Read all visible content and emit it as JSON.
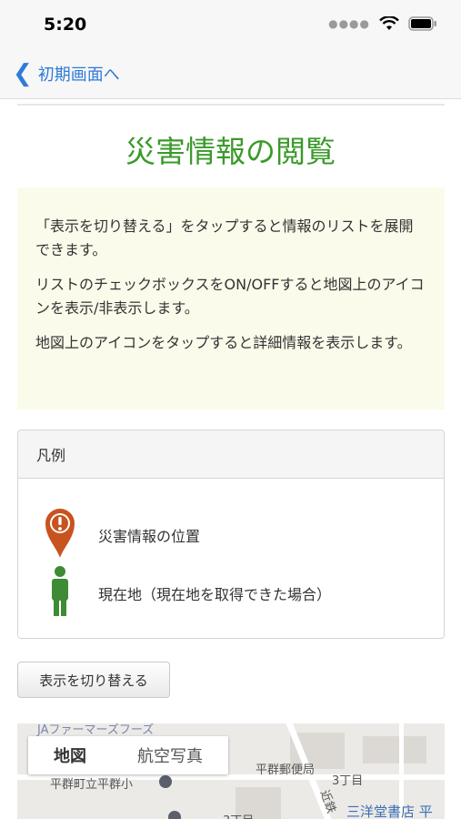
{
  "status_bar": {
    "time": "5:20"
  },
  "nav": {
    "back_label": "初期画面へ"
  },
  "page": {
    "title": "災害情報の閲覧"
  },
  "info": {
    "paragraphs": [
      "「表示を切り替える」をタップすると情報のリストを展開できます。",
      "リストのチェックボックスをON/OFFすると地図上のアイコンを表示/非表示します。",
      "地図上のアイコンをタップすると詳細情報を表示します。"
    ]
  },
  "legend": {
    "title": "凡例",
    "items": [
      {
        "icon": "disaster-pin-icon",
        "color": "#c8531f",
        "label": "災害情報の位置"
      },
      {
        "icon": "person-icon",
        "color": "#3f8a35",
        "label": "現在地（現在地を取得できた場合）"
      }
    ]
  },
  "toggle_button_label": "表示を切り替える",
  "map": {
    "tabs": [
      "地図",
      "航空写真"
    ],
    "active_tab": "地図",
    "labels": {
      "shop": "JAファーマーズフーズ",
      "post_office": "平群郵便局",
      "school": "平群町立平群小",
      "chome_1": "3丁目",
      "chome_2": "3丁目",
      "bookstore": "三洋堂書店 平",
      "road": "近鉄"
    }
  },
  "colors": {
    "accent_blue": "#2f7bd6",
    "title_green": "#3a9a2a",
    "info_bg": "#fbfbeb"
  }
}
